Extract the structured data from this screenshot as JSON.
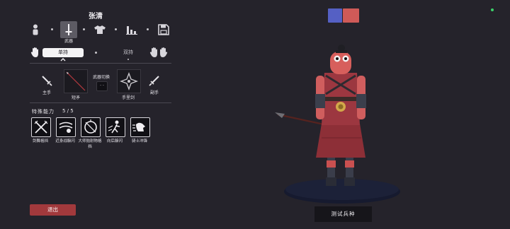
{
  "character_name": "张清",
  "tabs": [
    {
      "name": "character-tab",
      "icon": "person-icon"
    },
    {
      "name": "weapon-tab",
      "icon": "sword-icon",
      "label": "武器",
      "active": true
    },
    {
      "name": "clothing-tab",
      "icon": "shirt-icon"
    },
    {
      "name": "stats-tab",
      "icon": "bar-chart-icon"
    },
    {
      "name": "save-tab",
      "icon": "floppy-disk-icon"
    }
  ],
  "grip": {
    "single_label": "单持",
    "dual_label": "双持",
    "selected": "single"
  },
  "weapons": {
    "main_hand_label": "主手",
    "off_hand_label": "副手",
    "slot1_label": "短矛",
    "slot2_label": "手里剑",
    "switch_label": "武器切换",
    "switch_value": "· ·"
  },
  "abilities_section": {
    "title": "特殊能力",
    "count": "5 / 5",
    "items": [
      {
        "label": "剑舞格挡",
        "icon": "sword-dance-icon"
      },
      {
        "label": "近身战躲闪",
        "icon": "close-dodge-icon"
      },
      {
        "label": "大师抛射物格挡",
        "icon": "projectile-block-icon"
      },
      {
        "label": "向后躲闪",
        "icon": "back-dodge-icon"
      },
      {
        "label": "骑士冲锋",
        "icon": "knight-charge-icon"
      }
    ]
  },
  "exit_label": "退出",
  "test_unit_label": "测试兵种",
  "team_colors": [
    "#5560c4",
    "#cf5a58"
  ],
  "status_color": "#3bd16a"
}
